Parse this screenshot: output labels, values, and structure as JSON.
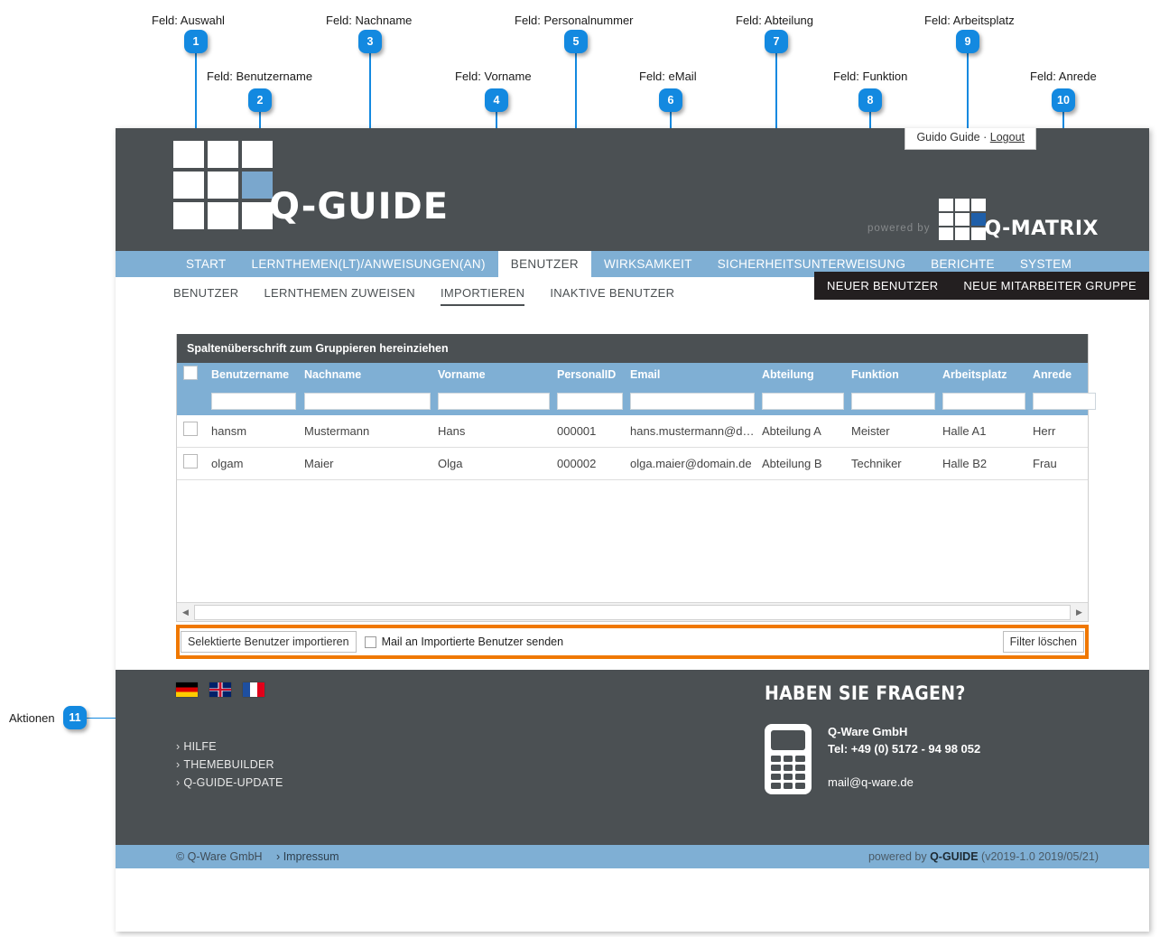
{
  "annotations": {
    "callouts": [
      {
        "n": "1",
        "label": "Feld: Auswahl"
      },
      {
        "n": "2",
        "label": "Feld: Benutzername"
      },
      {
        "n": "3",
        "label": "Feld: Nachname"
      },
      {
        "n": "4",
        "label": "Feld: Vorname"
      },
      {
        "n": "5",
        "label": "Feld: Personalnummer"
      },
      {
        "n": "6",
        "label": "Feld: eMail"
      },
      {
        "n": "7",
        "label": "Feld: Abteilung"
      },
      {
        "n": "8",
        "label": "Feld: Funktion"
      },
      {
        "n": "9",
        "label": "Feld: Arbeitsplatz"
      },
      {
        "n": "10",
        "label": "Feld: Anrede"
      },
      {
        "n": "11",
        "label": "Aktionen"
      }
    ],
    "accent_color": "#1389e0"
  },
  "header": {
    "user_name": "Guido Guide",
    "separator": "·",
    "logout_label": "Logout",
    "logo_text": "Q-GUIDE",
    "powered_by": "powered by",
    "partner_logo_text": "Q-MATRIX",
    "bg_color": "#4b5053",
    "accent_color": "#7fafd4"
  },
  "main_nav": {
    "items": [
      {
        "label": "START",
        "active": false
      },
      {
        "label": "LERNTHEMEN(LT)/ANWEISUNGEN(AN)",
        "active": false
      },
      {
        "label": "BENUTZER",
        "active": true
      },
      {
        "label": "WIRKSAMKEIT",
        "active": false
      },
      {
        "label": "SICHERHEITSUNTERWEISUNG",
        "active": false
      },
      {
        "label": "BERICHTE",
        "active": false
      },
      {
        "label": "SYSTEM",
        "active": false
      }
    ]
  },
  "sub_nav": {
    "items": [
      {
        "label": "BENUTZER",
        "active": false
      },
      {
        "label": "LERNTHEMEN ZUWEISEN",
        "active": false
      },
      {
        "label": "IMPORTIEREN",
        "active": true
      },
      {
        "label": "INAKTIVE BENUTZER",
        "active": false
      }
    ],
    "buttons": [
      {
        "label": "NEUER BENUTZER"
      },
      {
        "label": "NEUE MITARBEITER GRUPPE"
      }
    ]
  },
  "grid": {
    "group_hint": "Spaltenüberschrift zum Gruppieren hereinziehen",
    "columns": [
      "Benutzername",
      "Nachname",
      "Vorname",
      "PersonalID",
      "Email",
      "Abteilung",
      "Funktion",
      "Arbeitsplatz",
      "Anrede"
    ],
    "filter_values": [
      "",
      "",
      "",
      "",
      "",
      "",
      "",
      "",
      ""
    ],
    "rows": [
      {
        "selected": false,
        "cells": [
          "hansm",
          "Mustermann",
          "Hans",
          "000001",
          "hans.mustermann@d…",
          "Abteilung A",
          "Meister",
          "Halle A1",
          "Herr"
        ]
      },
      {
        "selected": false,
        "cells": [
          "olgam",
          "Maier",
          "Olga",
          "000002",
          "olga.maier@domain.de",
          "Abteilung B",
          "Techniker",
          "Halle B2",
          "Frau"
        ]
      }
    ],
    "scroll_left_icon": "triangle-left-icon",
    "scroll_right_icon": "triangle-right-icon"
  },
  "action_bar": {
    "import_button": "Selektierte Benutzer importieren",
    "mail_checkbox_label": "Mail an Importierte Benutzer senden",
    "mail_checkbox_checked": false,
    "clear_filter_button": "Filter löschen",
    "highlight_color": "#f07800"
  },
  "footer": {
    "languages": [
      {
        "name": "flag-de-icon",
        "title": "Deutsch"
      },
      {
        "name": "flag-uk-icon",
        "title": "English"
      },
      {
        "name": "flag-fr-icon",
        "title": "Français"
      }
    ],
    "links": [
      {
        "label": "HILFE"
      },
      {
        "label": "THEMEBUILDER"
      },
      {
        "label": "Q-GUIDE-UPDATE"
      }
    ],
    "chevron": "›",
    "contact": {
      "heading": "HABEN SIE FRAGEN?",
      "company": "Q-Ware GmbH",
      "phone": "Tel: +49 (0) 5172 - 94 98 052",
      "email": "mail@q-ware.de"
    },
    "bottom_bar": {
      "copyright": "© Q-Ware GmbH",
      "imprint": "Impressum",
      "powered_prefix": "powered by",
      "powered_brand": "Q-GUIDE",
      "version": "(v2019-1.0 2019/05/21)"
    }
  }
}
